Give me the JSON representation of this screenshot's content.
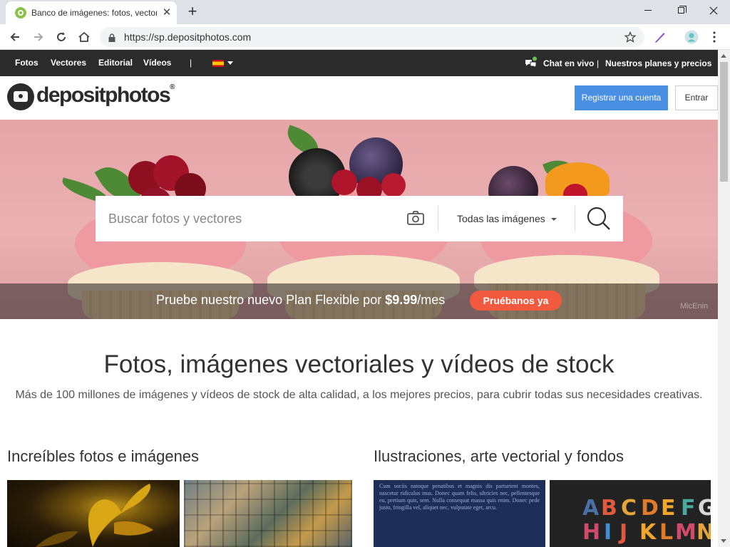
{
  "browser": {
    "tab_title": "Banco de imágenes: fotos, vectores",
    "url": "https://sp.depositphotos.com"
  },
  "site_nav": {
    "links": [
      "Fotos",
      "Vectores",
      "Editorial",
      "Vídeos"
    ],
    "separator": "|",
    "language": "ES",
    "chat": "Chat en vivo",
    "separator2": "|",
    "plans": "Nuestros planes y precios"
  },
  "header": {
    "logo_text": "depositphotos",
    "logo_reg": "®",
    "register_label": "Registrar una cuenta",
    "login_label": "Entrar"
  },
  "hero": {
    "search_placeholder": "Buscar fotos y vectores",
    "filter_label": "Todas las imágenes",
    "promo_prefix": "Pruebe nuestro nuevo Plan Flexible por ",
    "promo_price": "$9.99",
    "promo_suffix": "/mes",
    "promo_button": "Pruébanos ya",
    "credit": "MicEnin"
  },
  "main": {
    "title": "Fotos, imágenes vectoriales y vídeos de stock",
    "subtitle": "Más de 100 millones de imágenes y vídeos de stock de alta calidad, a los mejores precios, para cubrir todas sus necesidades creativas.",
    "sections": [
      {
        "title": "Increíbles fotos e imágenes"
      },
      {
        "title": "Ilustraciones, arte vectorial y fondos"
      }
    ],
    "thumb_text": "Cum sociis natoque penatibus et magnis dis parturient montes, nascetur ridiculus mus. Donec quam felis, ultricies nec, pellentesque eu, pretium quis, sem. Nulla consequat massa quis enim. Donec pede justo, fringilla vel, aliquet nec, vulputate eget, arcu.",
    "letters_row1": [
      "A",
      "B",
      "C",
      "D",
      "E",
      "F",
      "G"
    ],
    "letters_row2": [
      "H",
      "I",
      "J",
      "K",
      "L",
      "M",
      "N"
    ]
  },
  "colors": {
    "nav_bg": "#2b2b2b",
    "primary": "#4a90e2",
    "promo_button": "#f15a3f",
    "hero_bg": "#e6a5a8"
  },
  "icons": [
    "favicon-icon",
    "close-icon",
    "plus-icon",
    "minimize-icon",
    "maximize-icon",
    "window-close-icon",
    "back-icon",
    "forward-icon",
    "reload-icon",
    "home-icon",
    "lock-icon",
    "star-icon",
    "extension-icon",
    "profile-icon",
    "menu-icon",
    "chat-icon",
    "camera-icon",
    "search-icon",
    "caret-down-icon"
  ]
}
